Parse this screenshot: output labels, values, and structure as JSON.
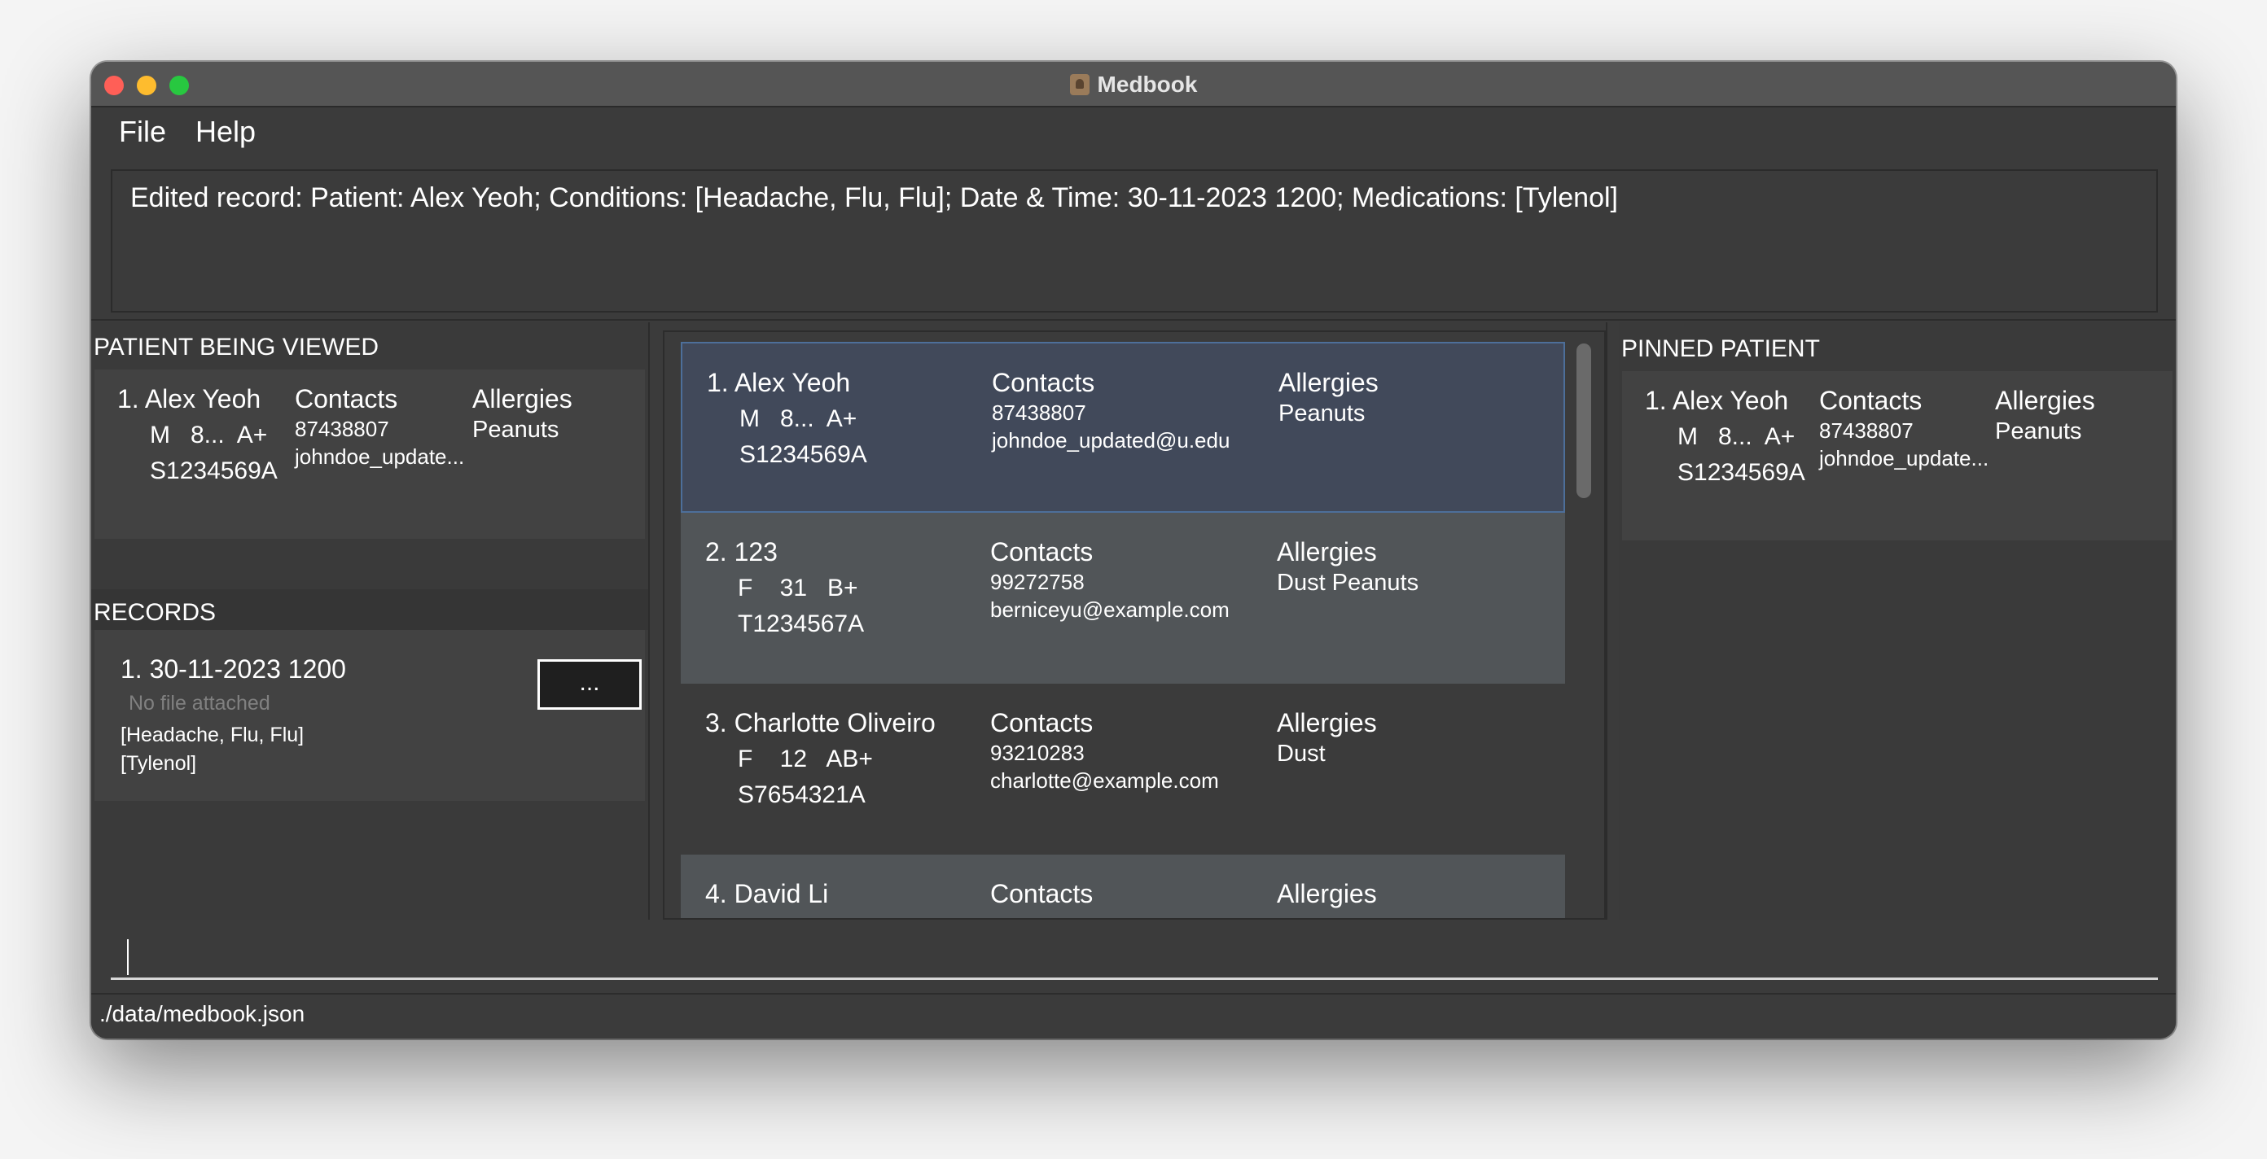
{
  "window": {
    "title": "Medbook"
  },
  "menu": {
    "file": "File",
    "help": "Help"
  },
  "result_display": "Edited record: Patient: Alex Yeoh; Conditions: [Headache, Flu, Flu]; Date & Time: 30-11-2023 1200; Medications: [Tylenol]",
  "patient_being_viewed": {
    "heading": "PATIENT BEING VIEWED",
    "name": "1. Alex Yeoh",
    "meta": "M   8...  A+",
    "nric": "S1234569A",
    "contacts_label": "Contacts",
    "phone": "87438807",
    "email": "johndoe_update...",
    "allergies_label": "Allergies",
    "allergies": "Peanuts"
  },
  "records": {
    "heading": "RECORDS",
    "items": [
      {
        "date": "1. 30-11-2023 1200",
        "file_status": "No file attached",
        "conditions": "[Headache, Flu, Flu]",
        "medications": "[Tylenol]",
        "more_label": "..."
      }
    ]
  },
  "patient_list": [
    {
      "name": "1. Alex Yeoh",
      "meta": "M   8...  A+",
      "nric": "S1234569A",
      "contacts_label": "Contacts",
      "phone": "87438807",
      "email": "johndoe_updated@u.edu",
      "allergies_label": "Allergies",
      "allergies": "Peanuts"
    },
    {
      "name": "2. 123",
      "meta": "F    31   B+",
      "nric": "T1234567A",
      "contacts_label": "Contacts",
      "phone": "99272758",
      "email": "berniceyu@example.com",
      "allergies_label": "Allergies",
      "allergies": "Dust Peanuts"
    },
    {
      "name": "3. Charlotte Oliveiro",
      "meta": "F    12   AB+",
      "nric": "S7654321A",
      "contacts_label": "Contacts",
      "phone": "93210283",
      "email": "charlotte@example.com",
      "allergies_label": "Allergies",
      "allergies": "Dust"
    },
    {
      "name": "4. David Li",
      "contacts_label": "Contacts",
      "allergies_label": "Allergies"
    }
  ],
  "pinned_patient": {
    "heading": "PINNED PATIENT",
    "name": "1. Alex Yeoh",
    "meta": "M   8...  A+",
    "nric": "S1234569A",
    "contacts_label": "Contacts",
    "phone": "87438807",
    "email": "johndoe_update...",
    "allergies_label": "Allergies",
    "allergies": "Peanuts"
  },
  "command_box": {
    "value": "",
    "placeholder": ""
  },
  "status_bar": "./data/medbook.json"
}
